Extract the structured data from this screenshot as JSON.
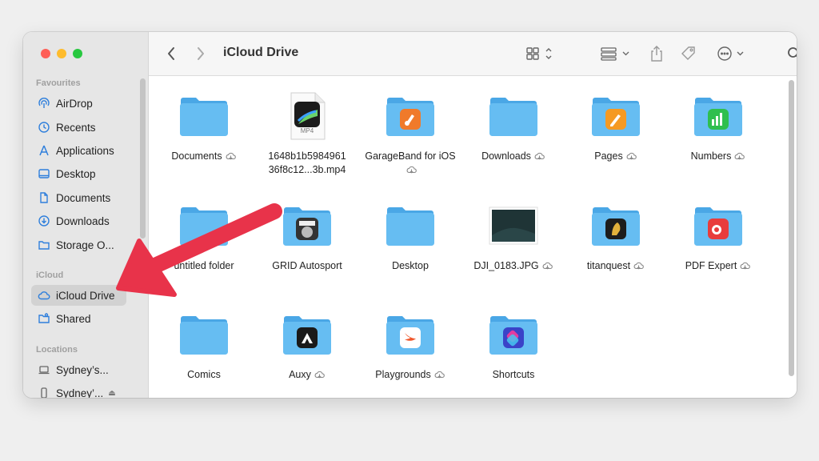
{
  "window": {
    "title": "iCloud Drive"
  },
  "sidebar": {
    "sections": [
      {
        "heading": "Favourites"
      },
      {
        "heading": "iCloud"
      },
      {
        "heading": "Locations"
      }
    ],
    "items": [
      {
        "label": "AirDrop",
        "icon": "airdrop-icon"
      },
      {
        "label": "Recents",
        "icon": "clock-icon"
      },
      {
        "label": "Applications",
        "icon": "applications-icon"
      },
      {
        "label": "Desktop",
        "icon": "desktop-icon"
      },
      {
        "label": "Documents",
        "icon": "document-icon"
      },
      {
        "label": "Downloads",
        "icon": "download-icon"
      },
      {
        "label": "Storage O...",
        "icon": "folder-icon"
      },
      {
        "label": "iCloud Drive",
        "icon": "cloud-icon",
        "selected": true
      },
      {
        "label": "Shared",
        "icon": "shared-folder-icon"
      },
      {
        "label": "Sydney’s...",
        "icon": "laptop-icon"
      },
      {
        "label": "Sydney’...",
        "icon": "phone-icon",
        "ejectable": true
      }
    ]
  },
  "files": [
    {
      "name": "Documents",
      "cloud": true,
      "kind": "folder"
    },
    {
      "name": "1648b1b5984961 36f8c12...3b.mp4",
      "cloud": false,
      "kind": "video",
      "badge": "MP4"
    },
    {
      "name": "GarageBand for iOS",
      "cloud": true,
      "kind": "app-folder",
      "app": "garageband"
    },
    {
      "name": "Downloads",
      "cloud": true,
      "kind": "folder"
    },
    {
      "name": "Pages",
      "cloud": true,
      "kind": "app-folder",
      "app": "pages"
    },
    {
      "name": "Numbers",
      "cloud": true,
      "kind": "app-folder",
      "app": "numbers"
    },
    {
      "name": "untitled folder",
      "cloud": false,
      "kind": "folder"
    },
    {
      "name": "GRID Autosport",
      "cloud": false,
      "kind": "app-folder",
      "app": "grid"
    },
    {
      "name": "Desktop",
      "cloud": false,
      "kind": "folder"
    },
    {
      "name": "DJI_0183.JPG",
      "cloud": true,
      "kind": "image"
    },
    {
      "name": "titanquest",
      "cloud": true,
      "kind": "app-folder",
      "app": "titanquest"
    },
    {
      "name": "PDF Expert",
      "cloud": true,
      "kind": "app-folder",
      "app": "pdfexpert"
    },
    {
      "name": "Comics",
      "cloud": false,
      "kind": "folder"
    },
    {
      "name": "Auxy",
      "cloud": true,
      "kind": "app-folder",
      "app": "auxy"
    },
    {
      "name": "Playgrounds",
      "cloud": true,
      "kind": "app-folder",
      "app": "playgrounds"
    },
    {
      "name": "Shortcuts",
      "cloud": false,
      "kind": "app-folder",
      "app": "shortcuts"
    }
  ],
  "colors": {
    "folder": "#66bdf2",
    "folder_tab": "#4aa7e6",
    "arrow": "#e8334a",
    "selection": "#d2d2d2"
  }
}
